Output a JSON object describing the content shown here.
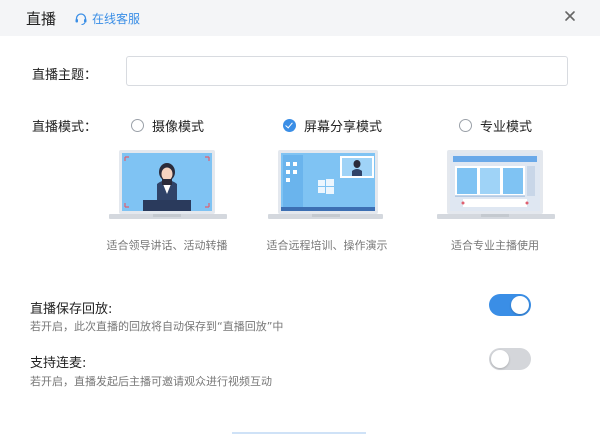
{
  "header": {
    "title": "直播",
    "support_label": "在线客服"
  },
  "form": {
    "topic_label": "直播主题：",
    "topic_value": "",
    "mode_label": "直播模式：",
    "modes": [
      {
        "label": "摄像模式",
        "checked": false,
        "caption": "适合领导讲话、活动转播"
      },
      {
        "label": "屏幕分享模式",
        "checked": true,
        "caption": "适合远程培训、操作演示"
      },
      {
        "label": "专业模式",
        "checked": false,
        "caption": "适合专业主播使用"
      }
    ]
  },
  "settings": [
    {
      "title": "直播保存回放:",
      "desc": "若开启，此次直播的回放将自动保存到“直播回放”中",
      "enabled": true
    },
    {
      "title": "支持连麦:",
      "desc": "若开启，直播发起后主播可邀请观众进行视频互动",
      "enabled": false
    }
  ],
  "colors": {
    "accent": "#3a8ee6",
    "header_bg": "#f4f5f7",
    "toggle_off": "#d4d6da"
  }
}
